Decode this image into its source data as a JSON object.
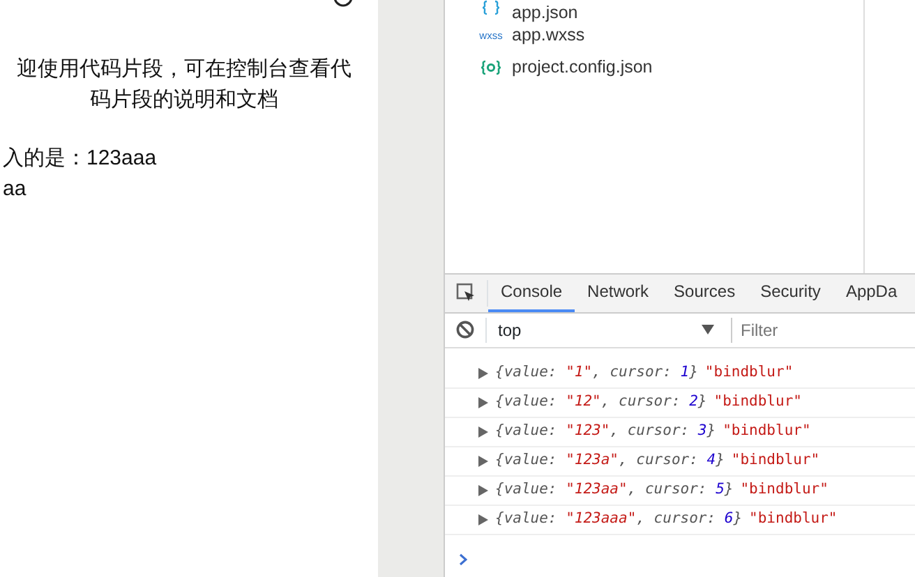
{
  "phone": {
    "intro_lines": [
      "迎使用代码片段，可在控制台查看代",
      "码片段的说明和文档"
    ],
    "output_lines": [
      "入的是：123aaa",
      "aa"
    ]
  },
  "files": [
    {
      "kind": "json",
      "name": "app.json"
    },
    {
      "kind": "wxss",
      "icon_text": "wxss",
      "name": "app.wxss"
    },
    {
      "kind": "config",
      "name": "project.config.json"
    }
  ],
  "devtools": {
    "tabs": [
      {
        "label": "Console",
        "selected": true
      },
      {
        "label": "Network",
        "selected": false
      },
      {
        "label": "Sources",
        "selected": false
      },
      {
        "label": "Security",
        "selected": false
      },
      {
        "label": "AppDa",
        "selected": false
      }
    ],
    "context": "top",
    "filter_placeholder": "Filter",
    "logs": [
      {
        "object": [
          {
            "kind": "punct",
            "text": "{value: "
          },
          {
            "kind": "string",
            "text": "\"1\""
          },
          {
            "kind": "punct",
            "text": ", cursor: "
          },
          {
            "kind": "number",
            "text": "1"
          },
          {
            "kind": "punct",
            "text": "}"
          }
        ],
        "message": "\"bindblur\""
      },
      {
        "object": [
          {
            "kind": "punct",
            "text": "{value: "
          },
          {
            "kind": "string",
            "text": "\"12\""
          },
          {
            "kind": "punct",
            "text": ", cursor: "
          },
          {
            "kind": "number",
            "text": "2"
          },
          {
            "kind": "punct",
            "text": "}"
          }
        ],
        "message": "\"bindblur\""
      },
      {
        "object": [
          {
            "kind": "punct",
            "text": "{value: "
          },
          {
            "kind": "string",
            "text": "\"123\""
          },
          {
            "kind": "punct",
            "text": ", cursor: "
          },
          {
            "kind": "number",
            "text": "3"
          },
          {
            "kind": "punct",
            "text": "}"
          }
        ],
        "message": "\"bindblur\""
      },
      {
        "object": [
          {
            "kind": "punct",
            "text": "{value: "
          },
          {
            "kind": "string",
            "text": "\"123a\""
          },
          {
            "kind": "punct",
            "text": ", cursor: "
          },
          {
            "kind": "number",
            "text": "4"
          },
          {
            "kind": "punct",
            "text": "}"
          }
        ],
        "message": "\"bindblur\""
      },
      {
        "object": [
          {
            "kind": "punct",
            "text": "{value: "
          },
          {
            "kind": "string",
            "text": "\"123aa\""
          },
          {
            "kind": "punct",
            "text": ", cursor: "
          },
          {
            "kind": "number",
            "text": "5"
          },
          {
            "kind": "punct",
            "text": "}"
          }
        ],
        "message": "\"bindblur\""
      },
      {
        "object": [
          {
            "kind": "punct",
            "text": "{value: "
          },
          {
            "kind": "string",
            "text": "\"123aaa\""
          },
          {
            "kind": "punct",
            "text": ", cursor: "
          },
          {
            "kind": "number",
            "text": "6"
          },
          {
            "kind": "punct",
            "text": "}"
          }
        ],
        "message": "\"bindblur\""
      }
    ]
  }
}
